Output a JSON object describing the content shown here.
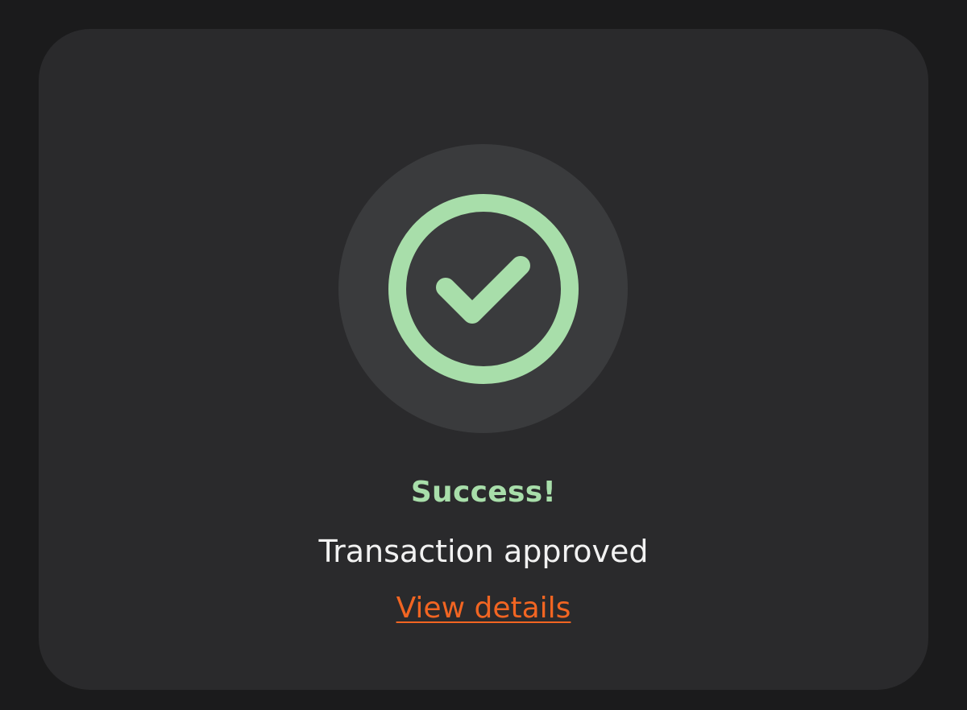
{
  "status": {
    "title": "Success!",
    "message": "Transaction approved",
    "link_label": "View details",
    "icon": "check-circle-icon"
  },
  "colors": {
    "page_background": "#1b1b1c",
    "card_background": "#2a2a2c",
    "icon_background": "#3a3b3d",
    "success": "#a8deaa",
    "link": "#f26522",
    "text": "#f2f2f2"
  }
}
